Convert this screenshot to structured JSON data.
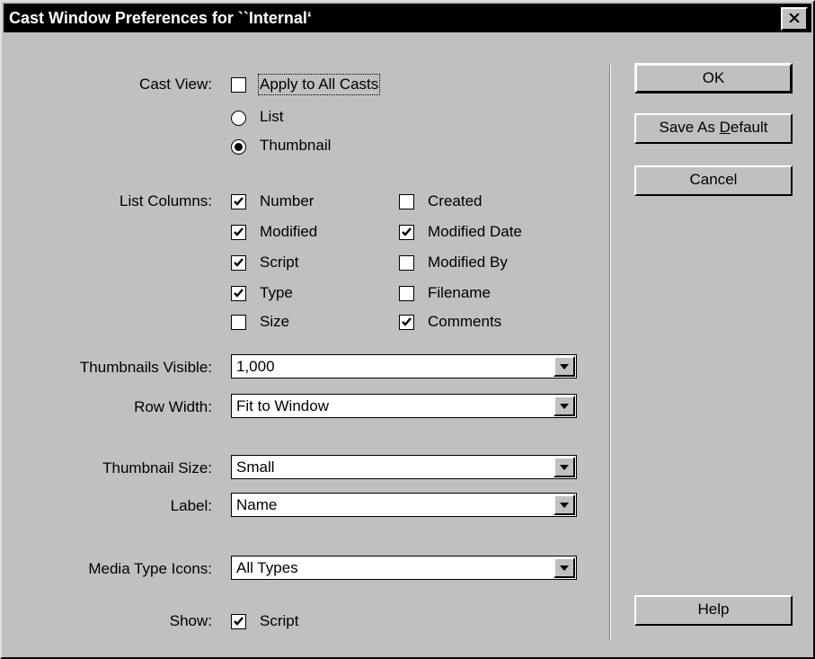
{
  "window": {
    "title": "Cast Window Preferences for ``Internal‘"
  },
  "cast_view": {
    "label": "Cast View:",
    "apply_all": {
      "label": "Apply to All Casts",
      "checked": false
    },
    "options": [
      {
        "label": "List",
        "selected": false
      },
      {
        "label": "Thumbnail",
        "selected": true
      }
    ]
  },
  "list_columns": {
    "label": "List Columns:",
    "items": [
      {
        "label": "Number",
        "checked": true
      },
      {
        "label": "Modified",
        "checked": true
      },
      {
        "label": "Script",
        "checked": true
      },
      {
        "label": "Type",
        "checked": true
      },
      {
        "label": "Size",
        "checked": false
      },
      {
        "label": "Created",
        "checked": false
      },
      {
        "label": "Modified Date",
        "checked": true
      },
      {
        "label": "Modified By",
        "checked": false
      },
      {
        "label": "Filename",
        "checked": false
      },
      {
        "label": "Comments",
        "checked": true
      }
    ]
  },
  "thumbnails_visible": {
    "label": "Thumbnails Visible:",
    "value": "1,000"
  },
  "row_width": {
    "label": "Row Width:",
    "value": "Fit to Window"
  },
  "thumbnail_size": {
    "label": "Thumbnail Size:",
    "value": "Small"
  },
  "label_field": {
    "label": "Label:",
    "value": "Name"
  },
  "media_type_icons": {
    "label": "Media Type Icons:",
    "value": "All Types"
  },
  "show": {
    "label": "Show:",
    "script": {
      "label": "Script",
      "checked": true
    }
  },
  "buttons": {
    "ok": "OK",
    "save_default_prefix": "Save As ",
    "save_default_mnemonic": "D",
    "save_default_suffix": "efault",
    "cancel": "Cancel",
    "help": "Help"
  }
}
